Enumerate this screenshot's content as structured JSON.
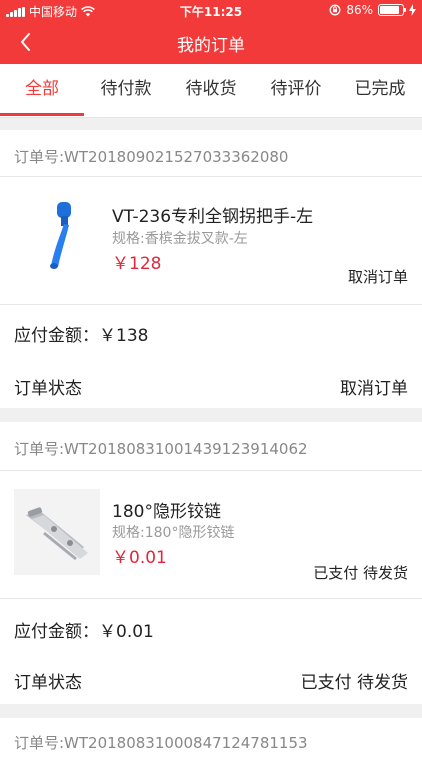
{
  "status_bar": {
    "carrier": "中国移动",
    "time": "下午11:25",
    "battery": "86%",
    "battery_level": 0.86
  },
  "nav": {
    "title": "我的订单"
  },
  "tabs": [
    "全部",
    "待付款",
    "待收货",
    "待评价",
    "已完成"
  ],
  "orders": [
    {
      "order_no": "订单号:WT20180902152703336 2080",
      "order_no_text": "订单号:WT2018090215270333 62080",
      "product_name": "VT-236专利全钢拐把手-左",
      "spec": "规格:香槟金拔叉款-左",
      "price": "￥128",
      "item_status": "取消订单",
      "payable": "应付金额：￥138",
      "status_label": "订单状态",
      "status_value": "取消订单"
    },
    {
      "order_no_text": "订单号:WT2018083100143912 3914062",
      "product_name": "180°隐形铰链",
      "spec": "规格:180°隐形铰链",
      "price": "￥0.01",
      "item_status": "已支付 待发货",
      "payable": "应付金额：￥0.01",
      "status_label": "订单状态",
      "status_value": "已支付 待发货"
    },
    {
      "order_no_text": "订单号:WT2018083100084712 4781153"
    }
  ]
}
